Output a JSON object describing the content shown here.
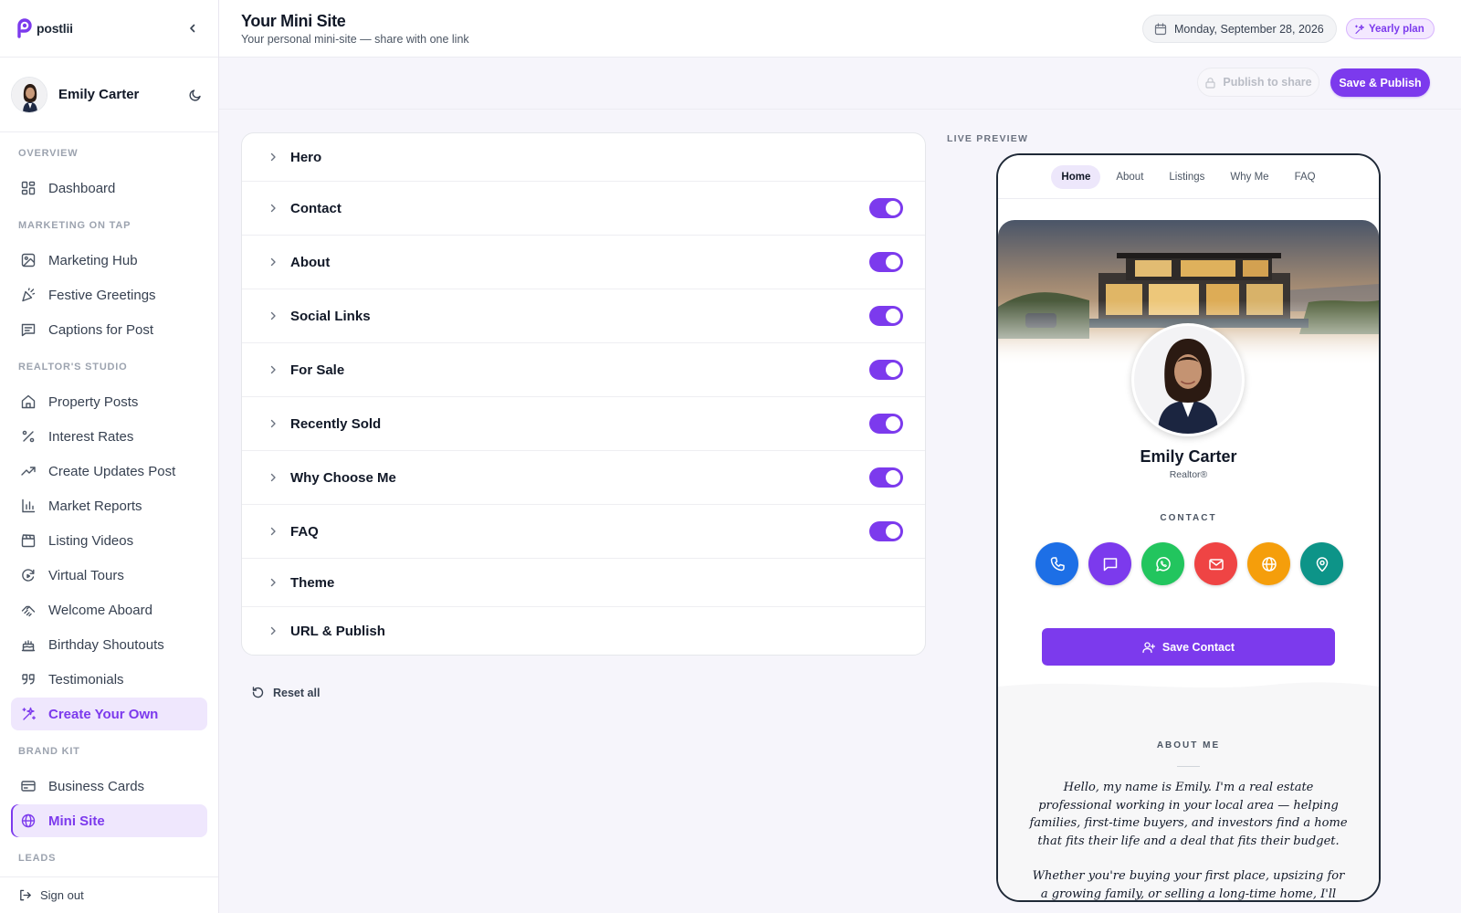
{
  "brand": {
    "name": "postlii",
    "color": "#7c3aed"
  },
  "user": {
    "name": "Emily Carter"
  },
  "sidebar": {
    "sections": [
      {
        "title": "OVERVIEW",
        "items": [
          {
            "label": "Dashboard",
            "icon": "dashboard-icon"
          }
        ]
      },
      {
        "title": "MARKETING ON TAP",
        "items": [
          {
            "label": "Marketing Hub",
            "icon": "image-icon"
          },
          {
            "label": "Festive Greetings",
            "icon": "party-icon"
          },
          {
            "label": "Captions for Post",
            "icon": "caption-icon"
          }
        ]
      },
      {
        "title": "REALTOR'S STUDIO",
        "items": [
          {
            "label": "Property Posts",
            "icon": "home-icon"
          },
          {
            "label": "Interest Rates",
            "icon": "percent-icon"
          },
          {
            "label": "Create Updates Post",
            "icon": "trending-icon"
          },
          {
            "label": "Market Reports",
            "icon": "bar-chart-icon"
          },
          {
            "label": "Listing Videos",
            "icon": "clapperboard-icon"
          },
          {
            "label": "Virtual Tours",
            "icon": "rotate-icon"
          },
          {
            "label": "Welcome Aboard",
            "icon": "handshake-icon"
          },
          {
            "label": "Birthday Shoutouts",
            "icon": "cake-icon"
          },
          {
            "label": "Testimonials",
            "icon": "quote-icon"
          },
          {
            "label": "Create Your Own",
            "icon": "sparkles-icon"
          }
        ]
      },
      {
        "title": "BRAND KIT",
        "items": [
          {
            "label": "Business Cards",
            "icon": "card-icon"
          },
          {
            "label": "Mini Site",
            "icon": "globe-icon"
          }
        ]
      },
      {
        "title": "LEADS",
        "items": []
      }
    ],
    "sign_out": "Sign out"
  },
  "header": {
    "title": "Your Mini Site",
    "subtitle": "Your personal mini-site — share with one link",
    "date": "Monday, September 28, 2026",
    "plan": "Yearly plan"
  },
  "actions": {
    "publish_to_share": "Publish to share",
    "save_publish": "Save & Publish"
  },
  "editor": {
    "sections": [
      {
        "label": "Hero",
        "toggle": null
      },
      {
        "label": "Contact",
        "toggle": true
      },
      {
        "label": "About",
        "toggle": true
      },
      {
        "label": "Social Links",
        "toggle": true
      },
      {
        "label": "For Sale",
        "toggle": true
      },
      {
        "label": "Recently Sold",
        "toggle": true
      },
      {
        "label": "Why Choose Me",
        "toggle": true
      },
      {
        "label": "FAQ",
        "toggle": true
      },
      {
        "label": "Theme",
        "toggle": null
      },
      {
        "label": "URL & Publish",
        "toggle": null
      }
    ],
    "reset": "Reset all"
  },
  "preview": {
    "label": "LIVE PREVIEW",
    "tabs": [
      "Home",
      "About",
      "Listings",
      "Why Me",
      "FAQ"
    ],
    "active_tab": "Home",
    "name": "Emily Carter",
    "role": "Realtor®",
    "contact_label": "CONTACT",
    "contact_buttons": [
      {
        "icon": "phone-icon",
        "color": "#1d6fe6"
      },
      {
        "icon": "message-icon",
        "color": "#7c3aed"
      },
      {
        "icon": "whatsapp-icon",
        "color": "#22c55e"
      },
      {
        "icon": "mail-icon",
        "color": "#ef4444"
      },
      {
        "icon": "globe-icon",
        "color": "#f59e0b"
      },
      {
        "icon": "map-pin-icon",
        "color": "#0d9488"
      }
    ],
    "save_contact": "Save Contact",
    "about_title": "ABOUT ME",
    "about_p1": "Hello, my name is Emily. I'm a real estate professional working in your local area — helping families, first-time buyers, and investors find a home that fits their life and a deal that fits their budget.",
    "about_p2": "Whether you're buying your first place, upsizing for a growing family, or selling a long-time home, I'll walk you"
  }
}
